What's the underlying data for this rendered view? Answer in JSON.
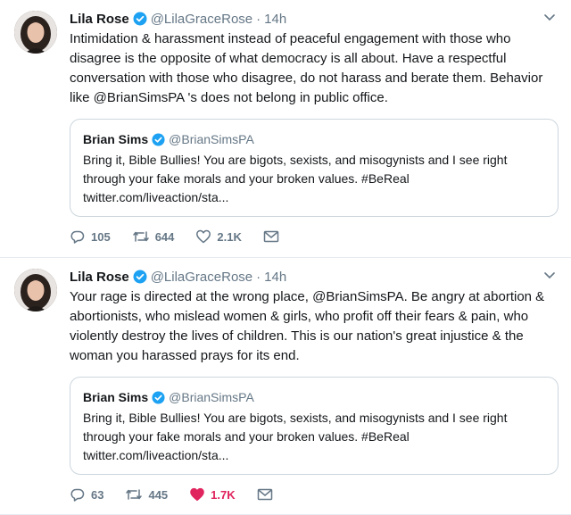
{
  "tweets": [
    {
      "author": {
        "name": "Lila Rose",
        "handle": "@LilaGraceRose",
        "time": "14h"
      },
      "text": "Intimidation & harassment instead of peaceful engagement with those who disagree is the opposite of what democracy is all about. Have a respectful conversation with those who disagree, do not harass and berate them. Behavior like @BrianSimsPA 's does not belong in public office.",
      "quote": {
        "name": "Brian Sims",
        "handle": "@BrianSimsPA",
        "text": "Bring it, Bible Bullies! You are bigots, sexists, and misogynists and I see right through your fake morals and your broken values. #BeReal twitter.com/liveaction/sta..."
      },
      "stats": {
        "replies": "105",
        "retweets": "644",
        "likes": "2.1K"
      },
      "liked": false
    },
    {
      "author": {
        "name": "Lila Rose",
        "handle": "@LilaGraceRose",
        "time": "14h"
      },
      "text": "Your rage is directed at the wrong place, @BrianSimsPA. Be angry at abortion & abortionists, who mislead women & girls, who profit off their fears & pain, who violently destroy the lives of children. This is our nation's great injustice & the woman you harassed prays for its end.",
      "quote": {
        "name": "Brian Sims",
        "handle": "@BrianSimsPA",
        "text": "Bring it, Bible Bullies! You are bigots, sexists, and misogynists and I see right through your fake morals and your broken values. #BeReal twitter.com/liveaction/sta..."
      },
      "stats": {
        "replies": "63",
        "retweets": "445",
        "likes": "1.7K"
      },
      "liked": true
    }
  ],
  "ui": {
    "separator_dot": "·",
    "colors": {
      "verified": "#1da1f2",
      "like_active": "#e0245e",
      "secondary_text": "#657786"
    }
  }
}
